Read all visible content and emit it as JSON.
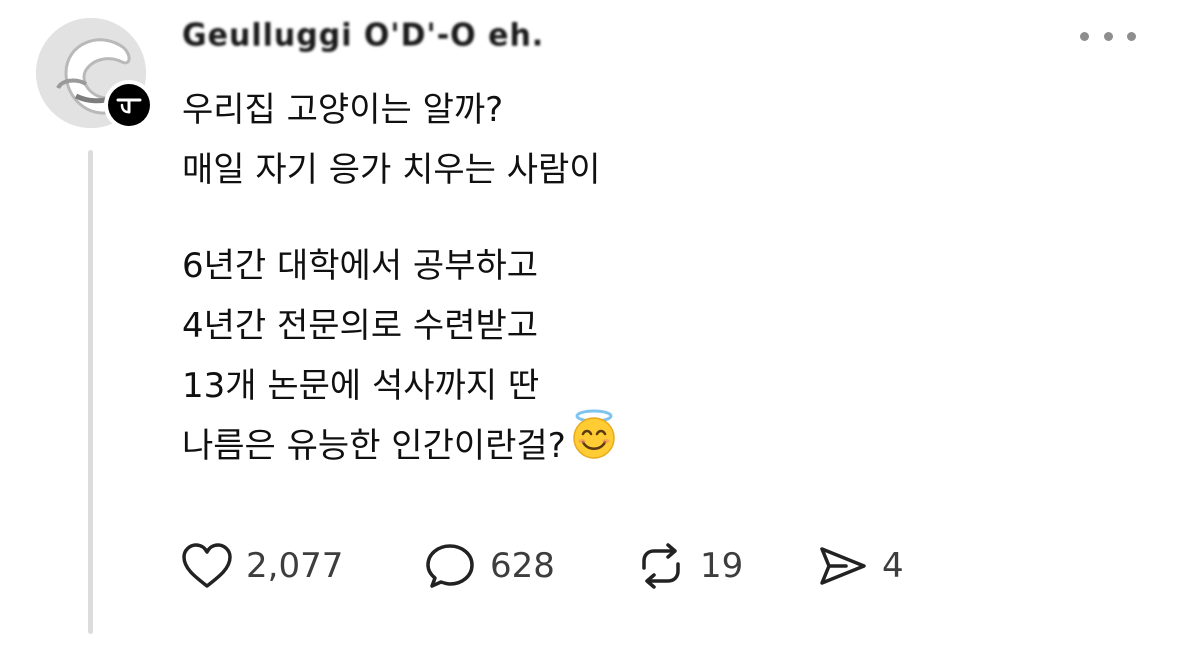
{
  "post": {
    "author": "Geulluggi O'D'-O eh.",
    "lines": [
      "우리집 고양이는 알까?",
      "매일 자기 응가 치우는 사람이",
      "",
      "6년간 대학에서 공부하고",
      "4년간 전문의로 수련받고",
      "13개 논문에 석사까지 딴",
      "나름은 유능한 인간이란걸?"
    ],
    "emoji": "smiling-face-with-halo"
  },
  "actions": {
    "likes": "2,077",
    "replies": "628",
    "reposts": "19",
    "shares": "4"
  },
  "colors": {
    "text": "#101010",
    "muted": "#3d3d3d",
    "thread_line": "#dcdcdc",
    "more_dots": "#8e8e8e",
    "emoji_face": "#ffcc33",
    "halo": "#7fc4f0"
  }
}
